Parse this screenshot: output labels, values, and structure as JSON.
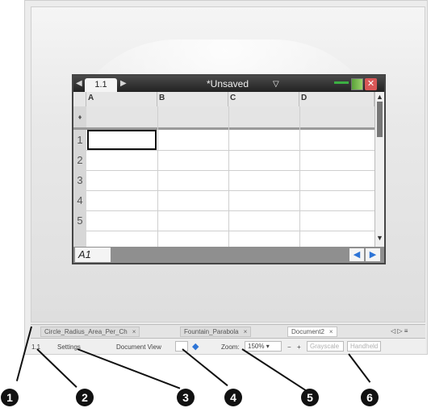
{
  "handheld": {
    "page_tab": "1.1",
    "document_title": "*Unsaved",
    "columns": [
      "A",
      "B",
      "C",
      "D"
    ],
    "formula_row_marker": "♦",
    "row_numbers": [
      "1",
      "2",
      "3",
      "4",
      "5"
    ],
    "cell_reference": "A1"
  },
  "document_tabs": [
    {
      "label": "Circle_Radius_Area_Per_Ch",
      "close": "×"
    },
    {
      "label": "Fountain_Parabola",
      "close": "×"
    },
    {
      "label": "Document2",
      "close": "×"
    }
  ],
  "tab_navigation": "◁ ▷ ≡",
  "status_bar": {
    "page_number": "1.1",
    "settings_label": "Settings",
    "document_view_label": "Document View",
    "zoom_label": "Zoom:",
    "zoom_value": "150%",
    "zoom_minus": "−",
    "zoom_plus": "+",
    "grey_1": "Grayscale",
    "grey_2": "Handheld"
  },
  "callouts": [
    "1",
    "2",
    "3",
    "4",
    "5",
    "6"
  ]
}
